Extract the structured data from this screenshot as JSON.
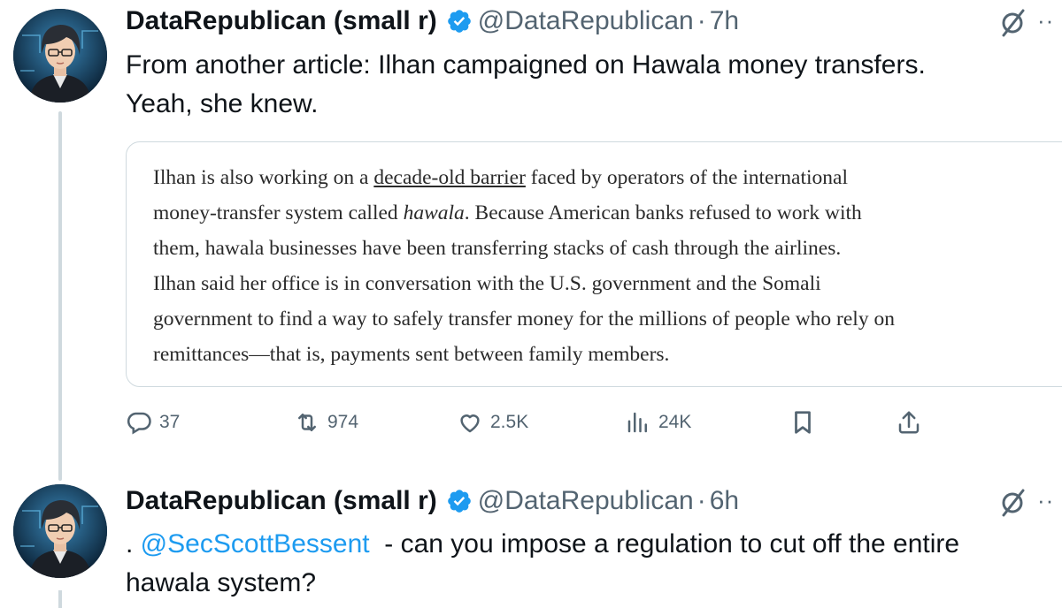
{
  "tweets": [
    {
      "display_name": "DataRepublican (small r)",
      "handle": "@DataRepublican",
      "separator": "·",
      "time": "7h",
      "more": "··",
      "text_line1": "From another article: Ilhan campaigned on Hawala money transfers.",
      "text_line2": "Yeah, she knew.",
      "quote": {
        "l1_a": "Ilhan is also working on a ",
        "l1_link": "decade-old barrier",
        "l1_b": " faced by  operators of the international",
        "l2_a": "money-transfer system called ",
        "l2_i": "hawala",
        "l2_b": ". Because American banks refused to work with",
        "l3": "them, hawala businesses have been transferring stacks of cash through the airlines.",
        "l4": "Ilhan said her office is in conversation with the U.S. government and the Somali",
        "l5": "government to find a way to safely transfer money for the millions of people who rely on",
        "l6": "remittances—that is, payments sent between family members."
      },
      "actions": {
        "replies": "37",
        "reposts": "974",
        "likes": "2.5K",
        "views": "24K"
      }
    },
    {
      "display_name": "DataRepublican (small r)",
      "handle": "@DataRepublican",
      "separator": "·",
      "time": "6h",
      "more": "··",
      "text_prefix": ". ",
      "mention": "@SecScottBessent",
      "text_rest": "  - can you impose a regulation to cut off the entire",
      "text_line2": "hawala system?"
    }
  ],
  "icons": {
    "verified": "verified-badge-icon",
    "grok": "grok-icon",
    "reply": "reply-icon",
    "repost": "repost-icon",
    "like": "heart-icon",
    "views": "views-icon",
    "bookmark": "bookmark-icon",
    "share": "share-icon"
  },
  "colors": {
    "accent": "#1d9bf0",
    "text": "#0f1419",
    "secondary": "#536471",
    "border": "#cfd9de"
  }
}
